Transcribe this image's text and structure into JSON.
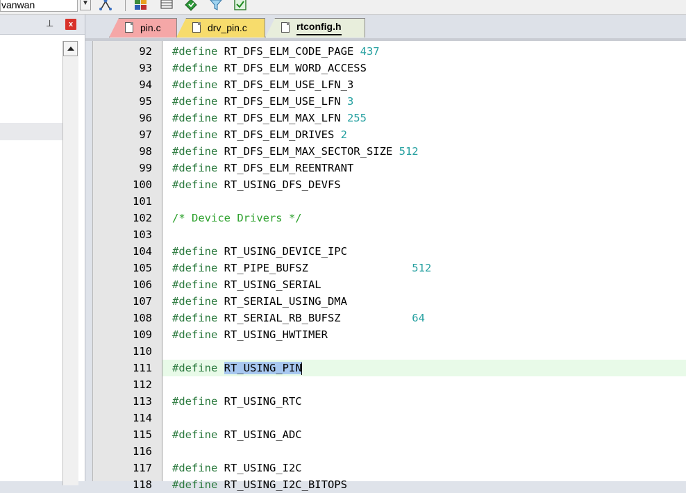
{
  "toolbar": {
    "target_text": "vanwan",
    "icons": [
      "target-options-icon",
      "manage-components-icon",
      "books-icon",
      "window-layout-icon",
      "download-icon",
      "filter-icon",
      "build-check-icon"
    ]
  },
  "left_panel": {
    "pin_glyph": "⊥",
    "close_glyph": "x"
  },
  "tabs": [
    {
      "label": "pin.c",
      "color": "#f5a7a7",
      "active": false
    },
    {
      "label": "drv_pin.c",
      "color": "#f7dc6c",
      "active": false
    },
    {
      "label": "rtconfig.h",
      "color": "#e8eedc",
      "active": true
    }
  ],
  "colors": {
    "keyword": "#2b7a3e",
    "number": "#25a0a0",
    "comment": "#2aa02a",
    "highlight_line": "#e8fae8",
    "selection": "#a8c8f0"
  },
  "editor": {
    "highlighted_line": 111,
    "selected_text": "RT_USING_PIN",
    "lines": [
      {
        "n": "92",
        "kw": "#define",
        "name": " RT_DFS_ELM_CODE_PAGE ",
        "val": "437"
      },
      {
        "n": "93",
        "kw": "#define",
        "name": " RT_DFS_ELM_WORD_ACCESS",
        "val": ""
      },
      {
        "n": "94",
        "kw": "#define",
        "name": " RT_DFS_ELM_USE_LFN_3",
        "val": ""
      },
      {
        "n": "95",
        "kw": "#define",
        "name": " RT_DFS_ELM_USE_LFN ",
        "val": "3"
      },
      {
        "n": "96",
        "kw": "#define",
        "name": " RT_DFS_ELM_MAX_LFN ",
        "val": "255"
      },
      {
        "n": "97",
        "kw": "#define",
        "name": " RT_DFS_ELM_DRIVES ",
        "val": "2"
      },
      {
        "n": "98",
        "kw": "#define",
        "name": " RT_DFS_ELM_MAX_SECTOR_SIZE ",
        "val": "512"
      },
      {
        "n": "99",
        "kw": "#define",
        "name": " RT_DFS_ELM_REENTRANT",
        "val": ""
      },
      {
        "n": "100",
        "kw": "#define",
        "name": " RT_USING_DFS_DEVFS",
        "val": ""
      },
      {
        "n": "101",
        "kw": "",
        "name": "",
        "val": ""
      },
      {
        "n": "102",
        "comment": "/* Device Drivers */"
      },
      {
        "n": "103",
        "kw": "",
        "name": "",
        "val": ""
      },
      {
        "n": "104",
        "kw": "#define",
        "name": " RT_USING_DEVICE_IPC",
        "val": ""
      },
      {
        "n": "105",
        "kw": "#define",
        "name": " RT_PIPE_BUFSZ                ",
        "val": "512"
      },
      {
        "n": "106",
        "kw": "#define",
        "name": " RT_USING_SERIAL",
        "val": ""
      },
      {
        "n": "107",
        "kw": "#define",
        "name": " RT_SERIAL_USING_DMA",
        "val": ""
      },
      {
        "n": "108",
        "kw": "#define",
        "name": " RT_SERIAL_RB_BUFSZ           ",
        "val": "64"
      },
      {
        "n": "109",
        "kw": "#define",
        "name": " RT_USING_HWTIMER",
        "val": ""
      },
      {
        "n": "110",
        "kw": "",
        "name": "",
        "val": ""
      },
      {
        "n": "111",
        "kw": "#define",
        "name": " ",
        "sel": "RT_USING_PIN",
        "val": ""
      },
      {
        "n": "112",
        "kw": "",
        "name": "",
        "val": ""
      },
      {
        "n": "113",
        "kw": "#define",
        "name": " RT_USING_RTC",
        "val": ""
      },
      {
        "n": "114",
        "kw": "",
        "name": "",
        "val": ""
      },
      {
        "n": "115",
        "kw": "#define",
        "name": " RT_USING_ADC",
        "val": ""
      },
      {
        "n": "116",
        "kw": "",
        "name": "",
        "val": ""
      },
      {
        "n": "117",
        "kw": "#define",
        "name": " RT_USING_I2C",
        "val": ""
      },
      {
        "n": "118",
        "kw": "#define",
        "name": " RT_USING_I2C_BITOPS",
        "val": ""
      }
    ]
  }
}
